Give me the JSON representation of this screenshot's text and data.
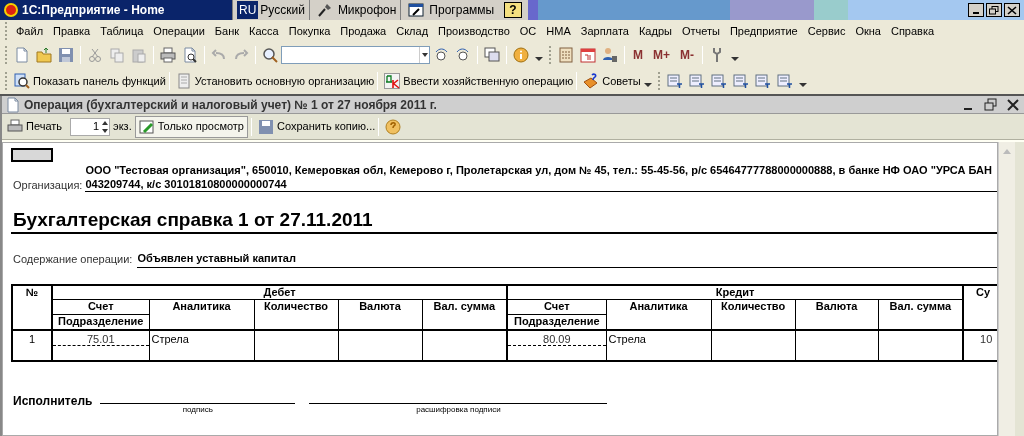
{
  "app_title": "1С:Предприятие - Home",
  "taskbar": [
    {
      "kind": "language",
      "badge": "RU",
      "label": "Русский"
    },
    {
      "kind": "microphone",
      "label": "Микрофон"
    },
    {
      "kind": "programs",
      "label": "Программы"
    },
    {
      "kind": "help",
      "label": "?"
    }
  ],
  "menu": [
    "Файл",
    "Правка",
    "Таблица",
    "Операции",
    "Банк",
    "Касса",
    "Покупка",
    "Продажа",
    "Склад",
    "Производство",
    "ОС",
    "НМА",
    "Зарплата",
    "Кадры",
    "Отчеты",
    "Предприятие",
    "Сервис",
    "Окна",
    "Справка"
  ],
  "memory_buttons": [
    "M",
    "M+",
    "M-"
  ],
  "toolbar2": [
    {
      "kind": "functions",
      "label": "Показать панель функций"
    },
    {
      "kind": "organization",
      "label": "Установить основную организацию"
    },
    {
      "kind": "operation",
      "label": "Ввести хозяйственную операцию"
    },
    {
      "kind": "tips",
      "label": "Советы"
    }
  ],
  "document": {
    "title": "Операция (бухгалтерский и налоговый учет) № 1 от 27 ноября 2011 г.",
    "toolbar": {
      "print": "Печать",
      "copies": "1",
      "copies_unit": "экз.",
      "view_only": {
        "label": "Только просмотр",
        "selected": true
      },
      "save_copy": "Сохранить копию..."
    },
    "organization_label": "Организация:",
    "organization_lines": [
      "ООО \"Тестовая организация\", 650010, Кемеровкая обл, Кемерово г, Пролетарская ул, дом № 45, тел.: 55-45-56, р/с 65464777788000000888, в банке НФ ОАО \"УРСА БАН",
      "043209744, к/с 30101810800000000744"
    ],
    "heading": "Бухгалтерская справка 1 от 27.11.2011",
    "content_label": "Содержание операции:",
    "content_value": "Объявлен уставный капитал",
    "table": {
      "number_header": "№",
      "groups": [
        {
          "title": "Дебет",
          "account": "Счет",
          "department": "Подразделение",
          "columns": [
            "Аналитика",
            "Количество",
            "Валюта",
            "Вал. сумма"
          ]
        },
        {
          "title": "Кредит",
          "account": "Счет",
          "department": "Подразделение",
          "columns": [
            "Аналитика",
            "Количество",
            "Валюта",
            "Вал. сумма"
          ]
        }
      ],
      "sum_header": "Су",
      "rows": [
        {
          "number": "1",
          "debit_account": "75.01",
          "debit_analytics": "Стрела",
          "credit_account": "80.09",
          "credit_analytics": "Стрела",
          "sum": "10"
        }
      ]
    },
    "signature": {
      "label": "Исполнитель",
      "captions": [
        "подпись",
        "расшифровка подписи"
      ]
    }
  }
}
